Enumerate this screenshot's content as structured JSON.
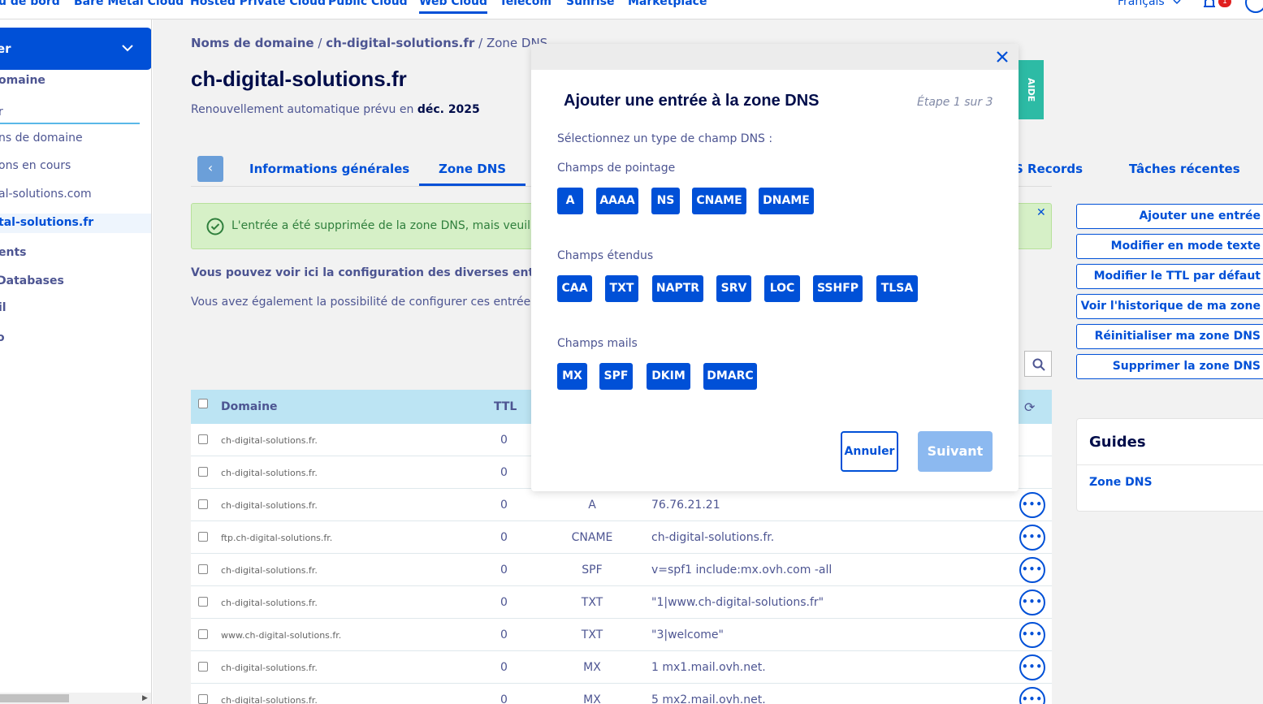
{
  "topnav": {
    "items": [
      "u de bord",
      "Bare Metal Cloud",
      "Hosted Private Cloud",
      "Public Cloud",
      "Web Cloud",
      "Telecom",
      "Sunrise",
      "Marketplace"
    ],
    "language": "Français",
    "notification_count": "1"
  },
  "sidebar": {
    "selector_label": "er",
    "section_title": "omaine",
    "search_value": "r",
    "items": [
      "ns de domaine",
      "ons en cours",
      "al-solutions.com",
      "tal-solutions.fr"
    ],
    "groups": [
      "ents",
      " Databases",
      "il",
      "o"
    ]
  },
  "breadcrumb": {
    "level1": "Noms de domaine",
    "level2": "ch-digital-solutions.fr",
    "level3": "Zone DNS",
    "sep": "/"
  },
  "page": {
    "title": "ch-digital-solutions.fr",
    "renew_prefix": "Renouvellement automatique prévu en",
    "renew_date": "déc. 2025",
    "help_label": "AIDE"
  },
  "tabs": {
    "back": "‹",
    "general": "Informations générales",
    "dns_zone": "Zone DNS",
    "records": "S Records",
    "tasks": "Tâches récentes"
  },
  "alert": {
    "message": "L'entrée a été supprimée de la zone DNS, mais veuillez",
    "close": "✕"
  },
  "description": {
    "line1": "Vous pouvez voir ici la configuration des diverses entrées d",
    "line2": "Vous avez également la possibilité de configurer ces entrées pe"
  },
  "table": {
    "headers": {
      "domain": "Domaine",
      "ttl": "TTL"
    },
    "rows": [
      {
        "domain": "ch-digital-solutions.fr.",
        "ttl": "0",
        "type": "",
        "target": ""
      },
      {
        "domain": "ch-digital-solutions.fr.",
        "ttl": "0",
        "type": "",
        "target": ""
      },
      {
        "domain": "ch-digital-solutions.fr.",
        "ttl": "0",
        "type": "A",
        "target": "76.76.21.21"
      },
      {
        "domain": "ftp.ch-digital-solutions.fr.",
        "ttl": "0",
        "type": "CNAME",
        "target": "ch-digital-solutions.fr."
      },
      {
        "domain": "ch-digital-solutions.fr.",
        "ttl": "0",
        "type": "SPF",
        "target": "v=spf1 include:mx.ovh.com -all"
      },
      {
        "domain": "ch-digital-solutions.fr.",
        "ttl": "0",
        "type": "TXT",
        "target": "\"1|www.ch-digital-solutions.fr\""
      },
      {
        "domain": "www.ch-digital-solutions.fr.",
        "ttl": "0",
        "type": "TXT",
        "target": "\"3|welcome\""
      },
      {
        "domain": "ch-digital-solutions.fr.",
        "ttl": "0",
        "type": "MX",
        "target": "1 mx1.mail.ovh.net."
      },
      {
        "domain": "ch-digital-solutions.fr.",
        "ttl": "0",
        "type": "MX",
        "target": "5 mx2.mail.ovh.net."
      }
    ],
    "more_label": "•••"
  },
  "actions": {
    "add_entry": "Ajouter une entrée",
    "edit_text": "Modifier en mode texte",
    "edit_ttl": "Modifier le TTL par défaut",
    "history": "Voir l'historique de ma zone",
    "reset": "Réinitialiser ma zone DNS",
    "delete": "Supprimer la zone DNS"
  },
  "guides": {
    "title": "Guides",
    "link": "Zone DNS"
  },
  "modal": {
    "title": "Ajouter une entrée à la zone DNS",
    "step": "Étape 1 sur 3",
    "prompt": "Sélectionnez un type de champ DNS :",
    "group1_label": "Champs de pointage",
    "group1": [
      "A",
      "AAAA",
      "NS",
      "CNAME",
      "DNAME"
    ],
    "group2_label": "Champs étendus",
    "group2": [
      "CAA",
      "TXT",
      "NAPTR",
      "SRV",
      "LOC",
      "SSHFP",
      "TLSA"
    ],
    "group3_label": "Champs mails",
    "group3": [
      "MX",
      "SPF",
      "DKIM",
      "DMARC"
    ],
    "cancel": "Annuler",
    "next": "Suivant"
  },
  "colors": {
    "primary": "#0050d7",
    "alert_bg": "#d6f0c7",
    "table_header": "#bce4f3",
    "help_tab": "#2dbba5",
    "disabled_button": "#8cb9f0"
  }
}
